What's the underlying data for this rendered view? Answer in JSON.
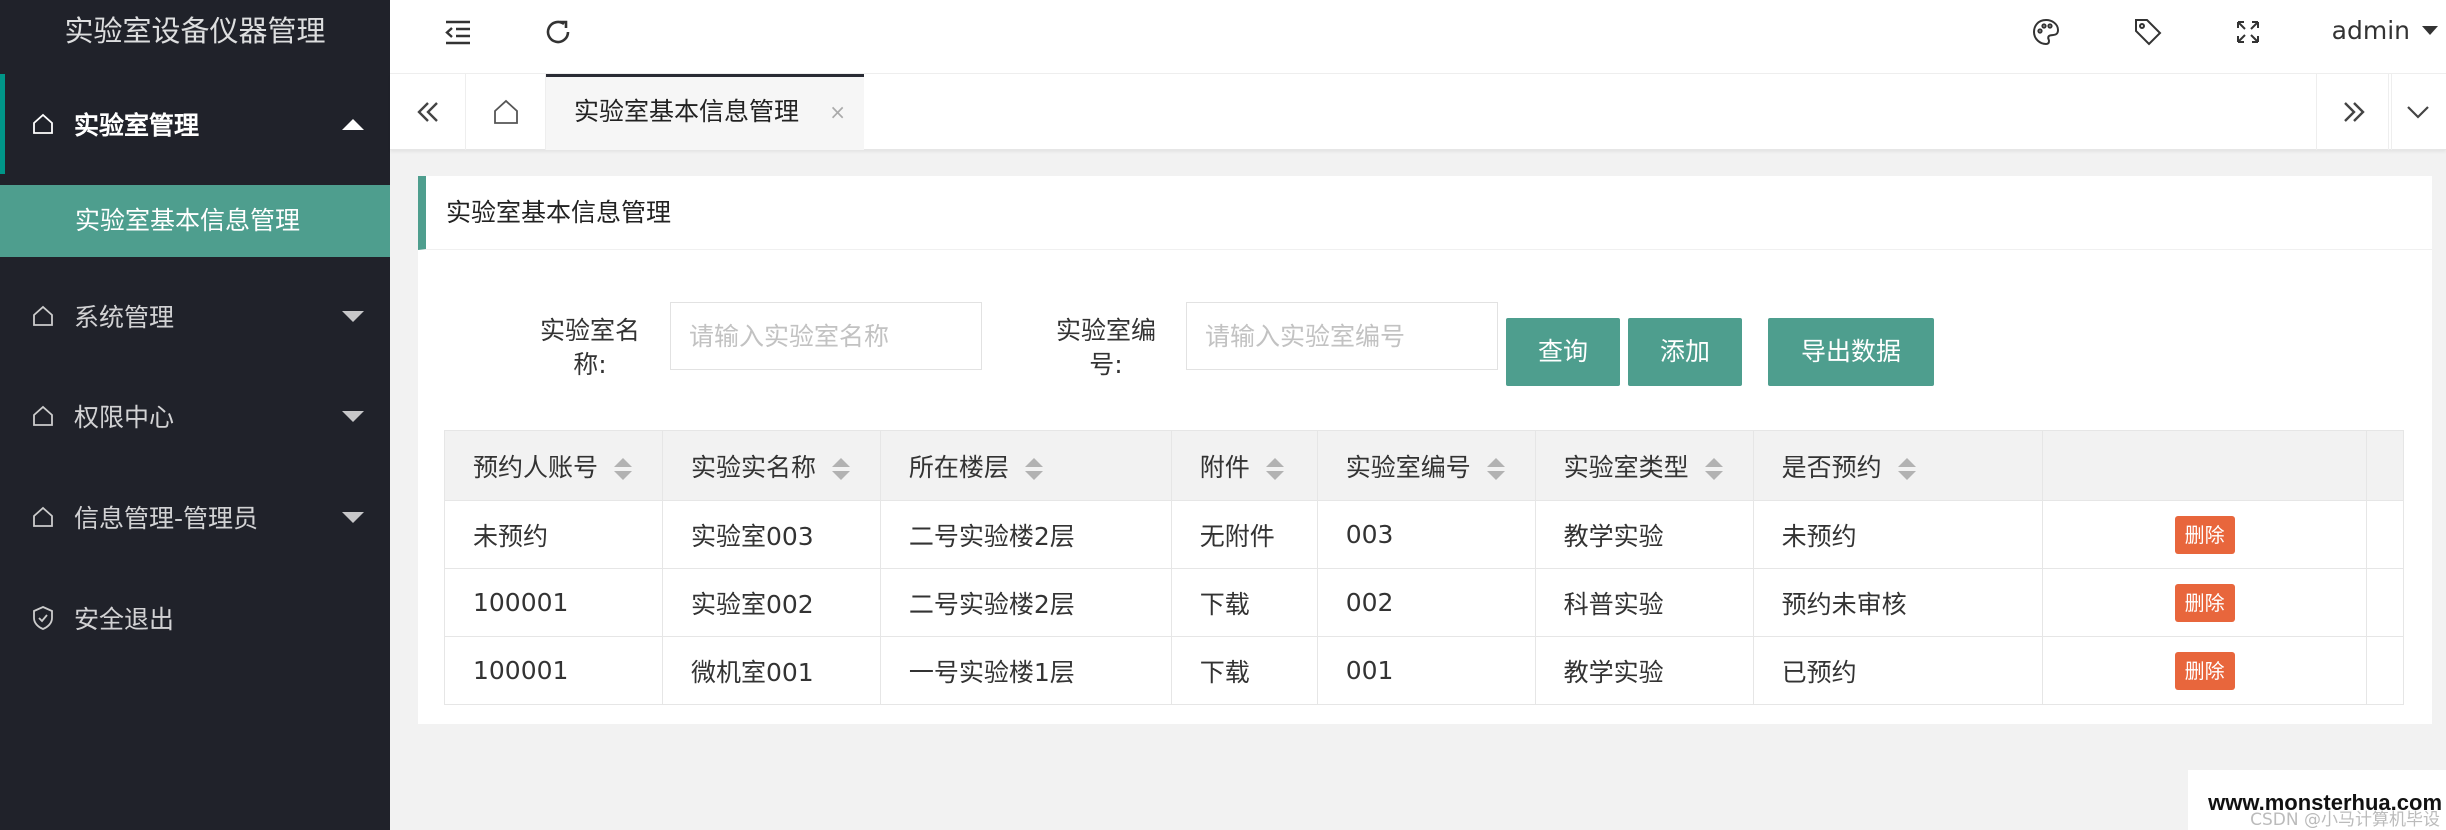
{
  "app": {
    "title": "实验室设备仪器管理"
  },
  "sidebar": {
    "items": [
      {
        "label": "实验室管理",
        "icon": "home-icon",
        "expanded": true
      },
      {
        "label": "系统管理",
        "icon": "home-icon",
        "expanded": false
      },
      {
        "label": "权限中心",
        "icon": "home-icon",
        "expanded": false
      },
      {
        "label": "信息管理-管理员",
        "icon": "home-icon",
        "expanded": false
      },
      {
        "label": "安全退出",
        "icon": "shield-check-icon"
      }
    ],
    "sub_item": "实验室基本信息管理"
  },
  "header": {
    "user": "admin",
    "icons": [
      "menu-fold-icon",
      "refresh-icon",
      "palette-icon",
      "tag-icon",
      "fullscreen-icon"
    ]
  },
  "tabs": {
    "active": "实验室基本信息管理",
    "close_glyph": "×"
  },
  "card": {
    "title": "实验室基本信息管理"
  },
  "search": {
    "name_label_line1": "实验室名",
    "name_label_line2": "称:",
    "name_placeholder": "请输入实验室名称",
    "code_label_line1": "实验室编",
    "code_label_line2": "号:",
    "code_placeholder": "请输入实验室编号",
    "query": "查询",
    "add": "添加",
    "export": "导出数据"
  },
  "table": {
    "headers": [
      "预约人账号",
      "实验实名称",
      "所在楼层",
      "附件",
      "实验室编号",
      "实验室类型",
      "是否预约"
    ],
    "delete_label": "删除",
    "rows": [
      {
        "account": "未预约",
        "name": "实验室003",
        "floor": "二号实验楼2层",
        "attachment": "无附件",
        "code": "003",
        "type": "教学实验",
        "reserved": "未预约"
      },
      {
        "account": "100001",
        "name": "实验室002",
        "floor": "二号实验楼2层",
        "attachment": "下载",
        "code": "002",
        "type": "科普实验",
        "reserved": "预约未审核"
      },
      {
        "account": "100001",
        "name": "微机室001",
        "floor": "一号实验楼1层",
        "attachment": "下载",
        "code": "001",
        "type": "教学实验",
        "reserved": "已预约"
      }
    ]
  },
  "watermark": {
    "main": "www.monsterhua.com",
    "sub": "CSDN @小马计算机毕设"
  },
  "colors": {
    "sidebar_bg": "#20222a",
    "accent": "#4e9e8e",
    "danger": "#e8663c"
  }
}
